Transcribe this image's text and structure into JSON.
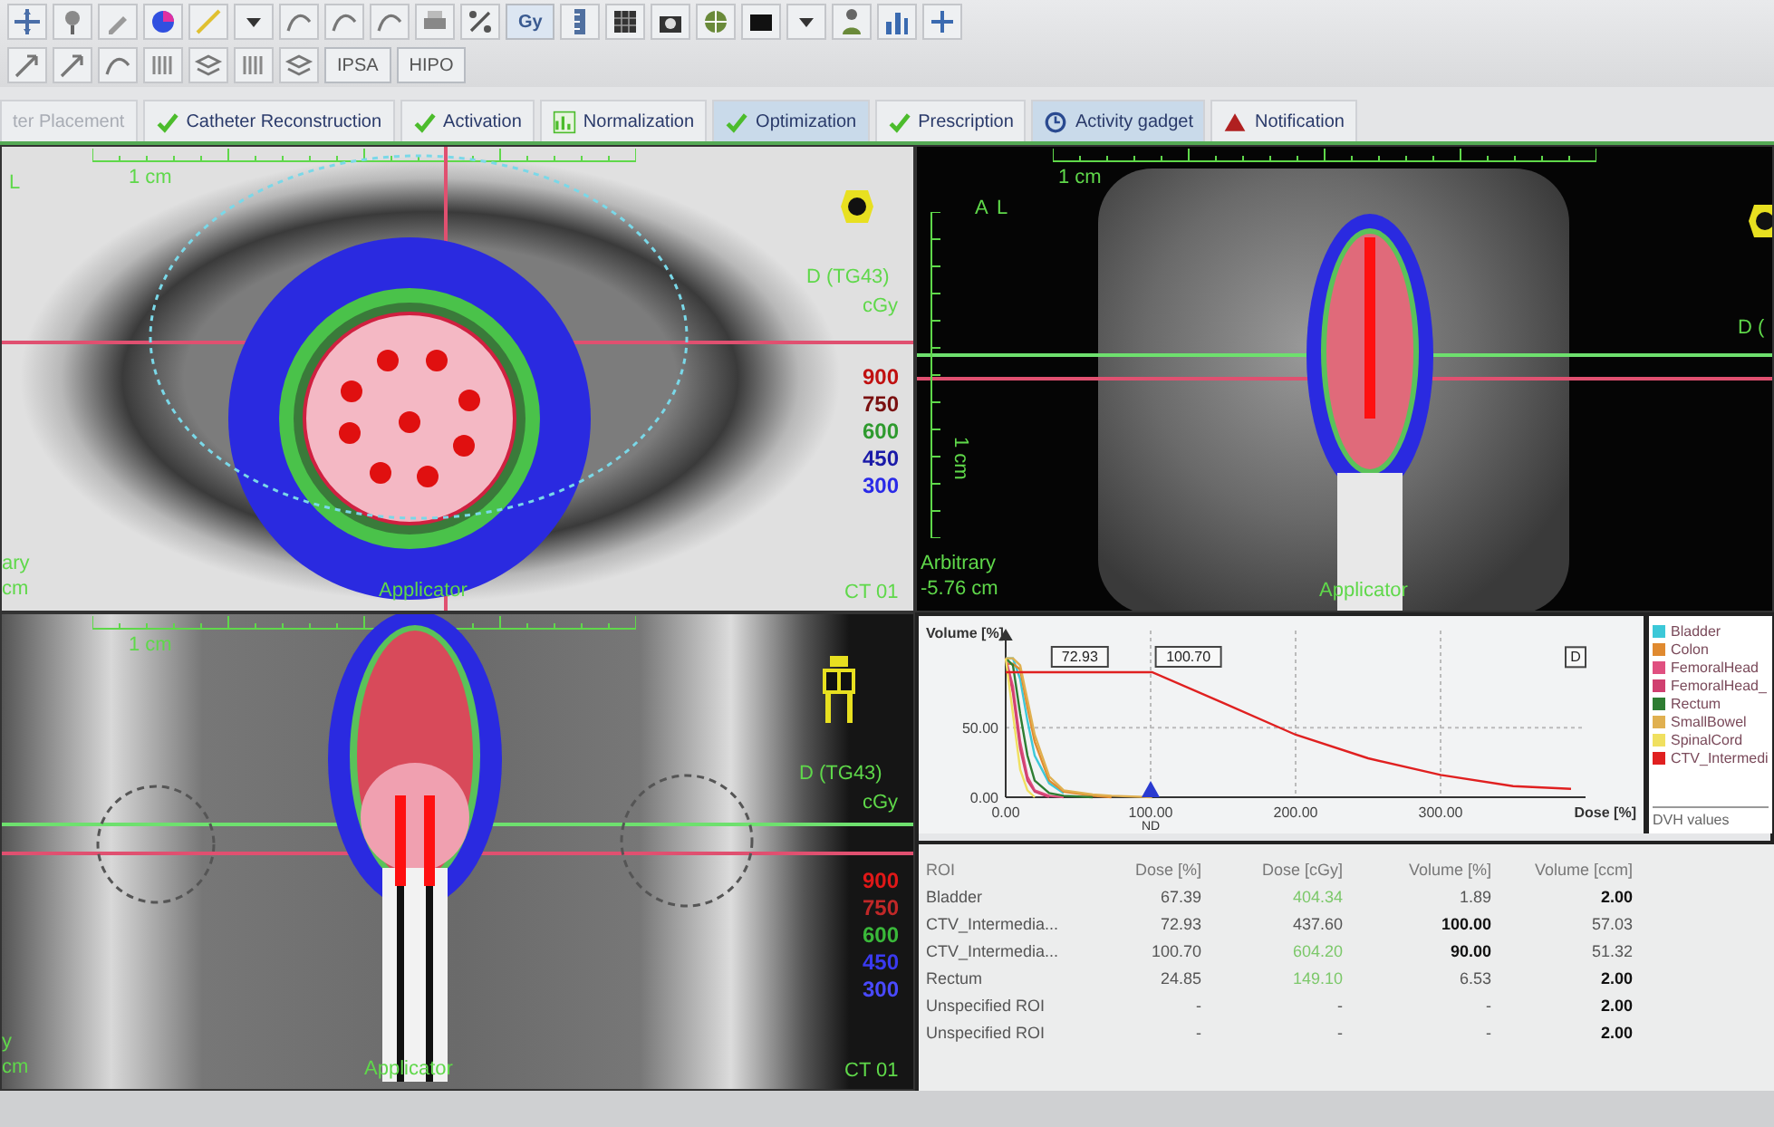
{
  "toolbar": {
    "row_1_labels": [
      "Gy"
    ],
    "row_2_labels": [
      "IPSA",
      "HIPO"
    ]
  },
  "tabs": [
    {
      "label": "ter Placement",
      "selected": false,
      "disabled": true
    },
    {
      "label": "Catheter Reconstruction",
      "kind": "step",
      "selected": false,
      "disabled": false
    },
    {
      "label": "Activation",
      "kind": "step",
      "selected": false,
      "disabled": false
    },
    {
      "label": "Normalization",
      "kind": "chart",
      "selected": false,
      "disabled": false
    },
    {
      "label": "Optimization",
      "kind": "step",
      "selected": true,
      "disabled": false
    },
    {
      "label": "Prescription",
      "kind": "step",
      "selected": false,
      "disabled": false
    },
    {
      "label": "Activity gadget",
      "kind": "gadget",
      "selected": true,
      "disabled": false
    },
    {
      "label": "Notification",
      "kind": "alert",
      "selected": false,
      "disabled": false
    }
  ],
  "views": [
    {
      "kind": "axial",
      "scale": "1 cm",
      "orientation": [
        "L"
      ],
      "dose_title": "D (TG43)",
      "dose_unit": "cGy",
      "dose_levels": [
        {
          "value": "900",
          "color": "#c01010"
        },
        {
          "value": "750",
          "color": "#7a1010"
        },
        {
          "value": "600",
          "color": "#2e9a2e"
        },
        {
          "value": "450",
          "color": "#1a1aa8"
        },
        {
          "value": "300",
          "color": "#2a2ae8"
        }
      ],
      "structure": "Applicator",
      "series": "CT 01",
      "position": [
        "ary",
        "cm"
      ]
    },
    {
      "kind": "sagittal",
      "scale": "1 cm",
      "vertical_scale": "1 cm",
      "orientation": [
        "A",
        "L"
      ],
      "dose_title": "D (",
      "position": [
        "Arbitrary",
        "-5.76 cm"
      ],
      "structure": "Applicator"
    },
    {
      "kind": "coronal",
      "scale": "1 cm",
      "dose_title": "D (TG43)",
      "dose_unit": "cGy",
      "dose_levels": [
        {
          "value": "900",
          "color": "#e01818"
        },
        {
          "value": "750",
          "color": "#c02828"
        },
        {
          "value": "600",
          "color": "#3ab83a"
        },
        {
          "value": "450",
          "color": "#3a3af0"
        },
        {
          "value": "300",
          "color": "#4a4aff"
        }
      ],
      "structure": "Applicator",
      "series": "CT 01",
      "position": [
        "y",
        "cm"
      ]
    }
  ],
  "dvh": {
    "chart_data": {
      "type": "line",
      "xlabel": "Dose [%]",
      "ylabel": "Volume [%]",
      "grid": true,
      "x": [
        0,
        5,
        10,
        15,
        20,
        30,
        40,
        60,
        73,
        101,
        150,
        200,
        250,
        300,
        350,
        390
      ],
      "series": [
        {
          "name": "Bladder",
          "color": "#3cc8d8",
          "values": [
            100,
            100,
            85,
            55,
            30,
            10,
            3,
            null,
            null,
            null,
            null,
            null,
            null,
            null,
            null,
            null
          ]
        },
        {
          "name": "Colon",
          "color": "#e08a30",
          "values": [
            96,
            96,
            92,
            65,
            40,
            12,
            4,
            1,
            0,
            null,
            null,
            null,
            null,
            null,
            null,
            null
          ]
        },
        {
          "name": "FemoralHead",
          "color": "#e05080",
          "values": [
            100,
            80,
            40,
            15,
            5,
            1,
            0,
            null,
            null,
            null,
            null,
            null,
            null,
            null,
            null,
            null
          ]
        },
        {
          "name": "FemoralHead_",
          "color": "#d04070",
          "values": [
            100,
            75,
            35,
            12,
            4,
            0,
            null,
            null,
            null,
            null,
            null,
            null,
            null,
            null,
            null,
            null
          ]
        },
        {
          "name": "Rectum",
          "color": "#2e7d32",
          "values": [
            100,
            95,
            60,
            30,
            12,
            3,
            1,
            0,
            null,
            null,
            null,
            null,
            null,
            null,
            null,
            null
          ]
        },
        {
          "name": "SmallBowel",
          "color": "#e0b050",
          "values": [
            100,
            100,
            95,
            70,
            45,
            15,
            5,
            2,
            1,
            0,
            null,
            null,
            null,
            null,
            null,
            null
          ]
        },
        {
          "name": "SpinalCord",
          "color": "#f0e060",
          "values": [
            100,
            60,
            20,
            5,
            0,
            null,
            null,
            null,
            null,
            null,
            null,
            null,
            null,
            null,
            null,
            null
          ]
        },
        {
          "name": "CTV_Intermedi",
          "color": "#e02020",
          "values": [
            90,
            90,
            90,
            90,
            90,
            90,
            90,
            90,
            90,
            90,
            68,
            45,
            28,
            16,
            8,
            6
          ]
        }
      ],
      "legend": "right",
      "xlim": [
        0,
        400
      ],
      "ylim": [
        0,
        120
      ],
      "xticks": [
        {
          "value": 0,
          "label": "0.00"
        },
        {
          "value": 100,
          "label": "100.00"
        },
        {
          "value": 200,
          "label": "200.00"
        },
        {
          "value": 300,
          "label": "300.00"
        }
      ],
      "yticks": [
        {
          "value": 0,
          "label": "0.00"
        },
        {
          "value": 50,
          "label": "50.00"
        }
      ],
      "annotations": [
        {
          "text": "72.93",
          "x": 73,
          "y": 90
        },
        {
          "text": "100.70",
          "x": 101,
          "y": 90
        },
        "D"
      ]
    },
    "marker": {
      "label": "ND"
    },
    "legend_footer": "DVH values"
  },
  "dvh_table": {
    "columns": [
      "ROI",
      "Dose [%]",
      "Dose [cGy]",
      "Volume [%]",
      "Volume [ccm]"
    ],
    "rows": [
      {
        "roi": "Bladder",
        "dose_pct": "67.39",
        "dose_cgy": "404.34",
        "volume_pct": "1.89",
        "volume_ccm": "2.00",
        "dose_cgy_marked": true,
        "volume_pct_bold": false,
        "volume_ccm_bold": true
      },
      {
        "roi": "CTV_Intermedia...",
        "dose_pct": "72.93",
        "dose_cgy": "437.60",
        "volume_pct": "100.00",
        "volume_ccm": "57.03",
        "dose_cgy_marked": false,
        "volume_pct_bold": true,
        "volume_ccm_bold": false
      },
      {
        "roi": "CTV_Intermedia...",
        "dose_pct": "100.70",
        "dose_cgy": "604.20",
        "volume_pct": "90.00",
        "volume_ccm": "51.32",
        "dose_cgy_marked": true,
        "volume_pct_bold": true,
        "volume_ccm_bold": false
      },
      {
        "roi": "Rectum",
        "dose_pct": "24.85",
        "dose_cgy": "149.10",
        "volume_pct": "6.53",
        "volume_ccm": "2.00",
        "dose_cgy_marked": true,
        "volume_pct_bold": false,
        "volume_ccm_bold": true
      },
      {
        "roi": "Unspecified ROI",
        "dose_pct": "-",
        "dose_cgy": "-",
        "volume_pct": "-",
        "volume_ccm": "2.00",
        "dose_cgy_marked": false,
        "volume_pct_bold": false,
        "volume_ccm_bold": true
      },
      {
        "roi": "Unspecified ROI",
        "dose_pct": "-",
        "dose_cgy": "-",
        "volume_pct": "-",
        "volume_ccm": "2.00",
        "dose_cgy_marked": false,
        "volume_pct_bold": false,
        "volume_ccm_bold": true
      }
    ]
  }
}
